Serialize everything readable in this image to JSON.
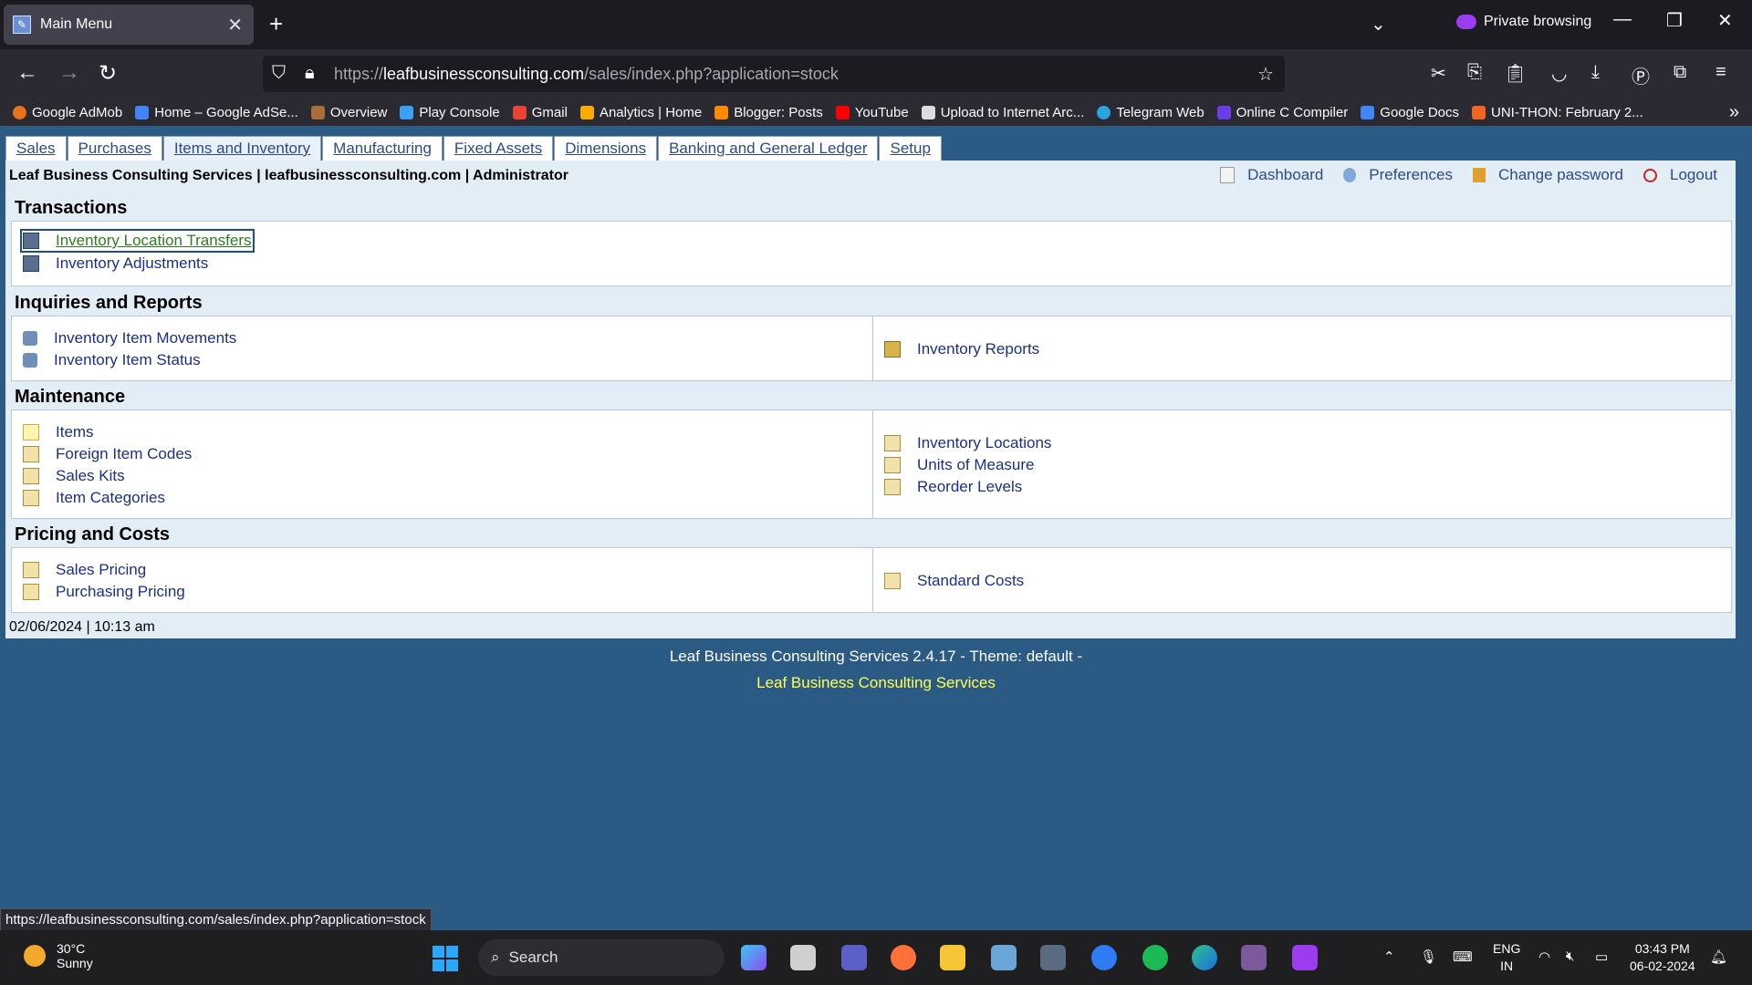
{
  "browser": {
    "tab_title": "Main Menu",
    "private_label": "Private browsing",
    "url_domain": "leafbusinessconsulting.com",
    "url_prefix": "https://",
    "url_path": "/sales/index.php?application=stock",
    "bookmarks": [
      "Google AdMob",
      "Home – Google AdSe...",
      "Overview",
      "Play Console",
      "Gmail",
      "Analytics | Home",
      "Blogger: Posts",
      "YouTube",
      "Upload to Internet Arc...",
      "Telegram Web",
      "Online C Compiler",
      "Google Docs",
      "UNI-THON: February 2..."
    ],
    "status_url": "https://leafbusinessconsulting.com/sales/index.php?application=stock"
  },
  "menu": {
    "tabs": [
      "Sales",
      "Purchases",
      "Items and Inventory",
      "Manufacturing",
      "Fixed Assets",
      "Dimensions",
      "Banking and General Ledger",
      "Setup"
    ],
    "active": "Items and Inventory"
  },
  "header": {
    "company": "Leaf Business Consulting Services | leafbusinessconsulting.com | Administrator",
    "links": [
      "Dashboard",
      "Preferences",
      "Change password",
      "Logout"
    ]
  },
  "sections": {
    "transactions": {
      "title": "Transactions",
      "left": [
        "Inventory Location Transfers",
        "Inventory Adjustments"
      ]
    },
    "inquiries": {
      "title": "Inquiries and Reports",
      "left": [
        "Inventory Item Movements",
        "Inventory Item Status"
      ],
      "right": [
        "Inventory Reports"
      ]
    },
    "maintenance": {
      "title": "Maintenance",
      "left": [
        "Items",
        "Foreign Item Codes",
        "Sales Kits",
        "Item Categories"
      ],
      "right": [
        "Inventory Locations",
        "Units of Measure",
        "Reorder Levels"
      ]
    },
    "pricing": {
      "title": "Pricing and Costs",
      "left": [
        "Sales Pricing",
        "Purchasing Pricing"
      ],
      "right": [
        "Standard Costs"
      ]
    }
  },
  "datetime": "02/06/2024 | 10:13 am",
  "footer": {
    "version": "Leaf Business Consulting Services 2.4.17 - Theme: default -",
    "link": "Leaf Business Consulting Services"
  },
  "taskbar": {
    "temp": "30°C",
    "weather": "Sunny",
    "search": "Search",
    "lang1": "ENG",
    "lang2": "IN",
    "time": "03:43 PM",
    "date": "06-02-2024"
  }
}
